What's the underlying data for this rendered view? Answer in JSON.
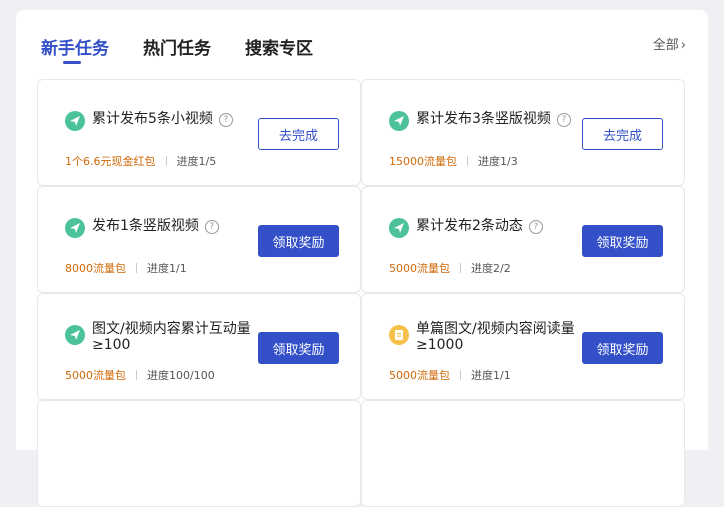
{
  "tabs": [
    {
      "label": "新手任务"
    },
    {
      "label": "热门任务"
    },
    {
      "label": "搜索专区"
    }
  ],
  "all_link": {
    "label": "全部"
  },
  "icons": {
    "plane": "paper-plane-icon",
    "doc": "document-icon",
    "help": "question-circle-icon"
  },
  "colors": {
    "accent": "#3350c9",
    "green_icon": "#4cc29c",
    "yellow_icon": "#f5c14b",
    "reward": "#d06a0a"
  },
  "tasks": [
    {
      "title": "累计发布5条小视频",
      "reward": "1个6.6元现金红包",
      "progress": "进度1/5",
      "button": "去完成"
    },
    {
      "title": "累计发布3条竖版视频",
      "reward": "15000流量包",
      "progress": "进度1/3",
      "button": "去完成"
    },
    {
      "title": "发布1条竖版视频",
      "reward": "8000流量包",
      "progress": "进度1/1",
      "button": "领取奖励"
    },
    {
      "title": "累计发布2条动态",
      "reward": "5000流量包",
      "progress": "进度2/2",
      "button": "领取奖励"
    },
    {
      "title": "图文/视频内容累计互动量≥100",
      "reward": "5000流量包",
      "progress": "进度100/100",
      "button": "领取奖励"
    },
    {
      "title": "单篇图文/视频内容阅读量≥1000",
      "reward": "5000流量包",
      "progress": "进度1/1",
      "button": "领取奖励"
    }
  ]
}
